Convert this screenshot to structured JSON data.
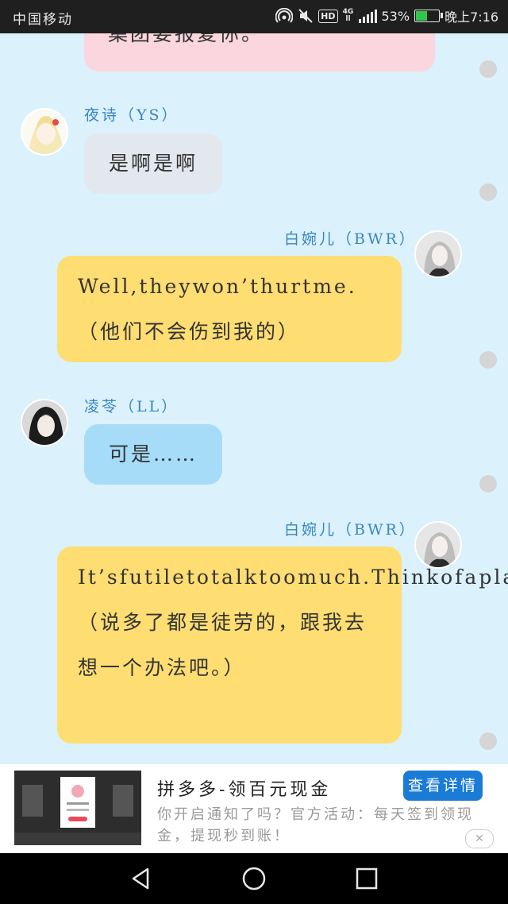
{
  "status_bar": {
    "carrier": "中国移动",
    "battery_percent": "53%",
    "battery_level": 0.53,
    "time": "晚上7:16",
    "icons": [
      "hotspot-icon",
      "mute-icon",
      "hd-icon",
      "4g-icon",
      "signal-icon",
      "battery-icon"
    ],
    "net_top": "4G",
    "net_bottom": "ll",
    "hd": "HD"
  },
  "chat": {
    "messages": [
      {
        "speaker": "",
        "text": "集团要报复你。",
        "style": "pink"
      },
      {
        "speaker": "夜诗（YS）",
        "text": "是啊是啊",
        "style": "gray"
      },
      {
        "speaker": "白婉儿（BWR）",
        "text": "Well,theywon’thurtme.（他们不会伤到我的）",
        "style": "yellow"
      },
      {
        "speaker": "凌苓（LL）",
        "text": "可是……",
        "style": "blue"
      },
      {
        "speaker": "白婉儿（BWR）",
        "text": "It’sfutiletotalktoomuch.Thinkofaplanwithme.（说多了都是徒劳的，跟我去想一个办法吧。）",
        "style": "yellow"
      }
    ]
  },
  "ad": {
    "title": "拼多多-领百元现金",
    "description": "你开启通知了吗？官方活动：每天签到领现金，提现秒到账！",
    "button": "查看详情",
    "close": "✕"
  },
  "nav": {
    "icons": [
      "back-icon",
      "home-icon",
      "recents-icon"
    ]
  },
  "colors": {
    "background": "#dbf1fb",
    "pink_bubble": "#fbd6df",
    "gray_bubble": "#e3e7ee",
    "yellow_bubble": "#fedd72",
    "blue_bubble": "#a6dcf8",
    "name_color": "#3a86c2",
    "ad_button": "#1a7cd6"
  }
}
